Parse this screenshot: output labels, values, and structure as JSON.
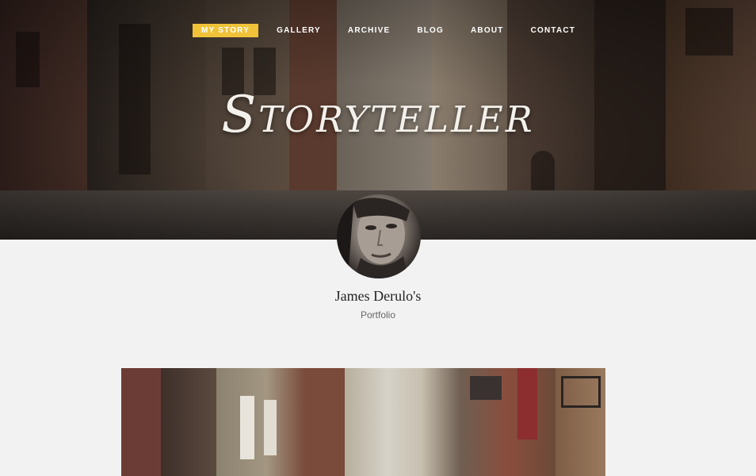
{
  "nav": {
    "items": [
      {
        "label": "MY STORY",
        "active": true
      },
      {
        "label": "GALLERY",
        "active": false
      },
      {
        "label": "ARCHIVE",
        "active": false
      },
      {
        "label": "BLOG",
        "active": false
      },
      {
        "label": "ABOUT",
        "active": false
      },
      {
        "label": "CONTACT",
        "active": false
      }
    ],
    "active_color": "#f0c238"
  },
  "brand": {
    "title": "Storyteller"
  },
  "profile": {
    "name": "James Derulo's",
    "subtitle": "Portfolio"
  },
  "colors": {
    "accent": "#f0c238",
    "page_background": "#f2f2f2",
    "text": "#222222"
  }
}
